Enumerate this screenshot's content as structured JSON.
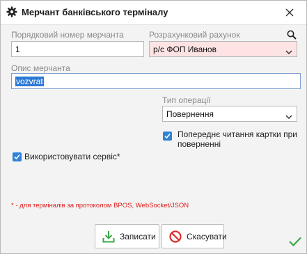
{
  "window": {
    "title": "Мерчант банківського терміналу"
  },
  "fields": {
    "merchant_no_label": "Порядковий номер мерчанта",
    "merchant_no_value": "1",
    "account_label": "Розрахунковий рахунок",
    "account_value": "р/с ФОП Иванов",
    "description_label": "Опис мерчанта",
    "description_value": "vozvrat",
    "operation_label": "Тип операції",
    "operation_value": "Повернення"
  },
  "checkboxes": {
    "preread_line1": "Попереднє читання картки при",
    "preread_line2": "поверненні",
    "preread_checked": true,
    "use_service": "Використовувати сервіс*",
    "use_service_checked": true
  },
  "note": "* - для терміналів за протоколом BPOS, WebSocket/JSON",
  "buttons": {
    "save": "Записати",
    "cancel": "Скасувати"
  },
  "icons": {
    "title": "gear-icon",
    "close": "close-icon",
    "search": "search-icon",
    "chevron": "chevron-down-icon",
    "save": "download-icon",
    "cancel": "no-entry-icon",
    "ok": "checkmark-icon"
  },
  "colors": {
    "accent": "#2f82d8",
    "account_bg": "#fde3e3",
    "selection": "#2d7ad6",
    "note": "#e01818",
    "save_icon": "#3aa845",
    "cancel_icon": "#e0282c",
    "ok": "#3aa845"
  }
}
